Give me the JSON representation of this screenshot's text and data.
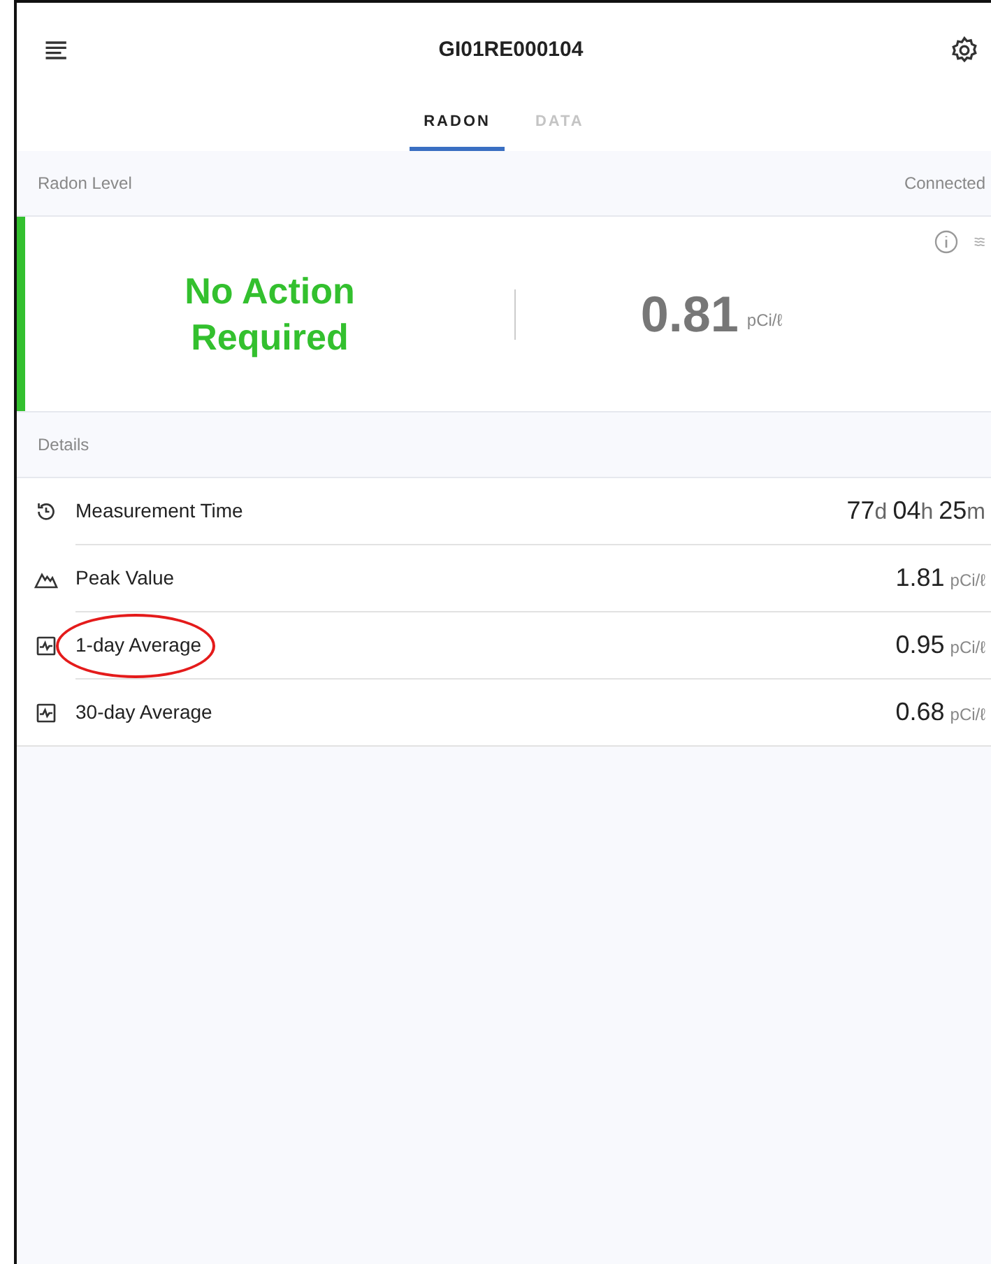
{
  "header": {
    "title": "GI01RE000104"
  },
  "tabs": [
    {
      "label": "RADON",
      "selected": true
    },
    {
      "label": "DATA",
      "selected": false
    }
  ],
  "radon_level": {
    "label": "Radon Level",
    "connection": "Connected",
    "status": "No Action Required",
    "color": "#33c02e",
    "value": "0.81",
    "unit": "pCi/ℓ"
  },
  "details": {
    "label": "Details",
    "rows": [
      {
        "kind": "clock",
        "label": "Measurement Time",
        "circled": false,
        "value_parts": [
          {
            "number": "77",
            "unit": "d"
          },
          {
            "number": "04",
            "unit": "h"
          },
          {
            "number": "25",
            "unit": "m"
          }
        ]
      },
      {
        "kind": "peak",
        "label": "Peak Value",
        "circled": false,
        "value_parts": [
          {
            "number": "1.81",
            "unit": "pCi/ℓ"
          }
        ]
      },
      {
        "kind": "chart",
        "label": "1-day Average",
        "circled": true,
        "value_parts": [
          {
            "number": "0.95",
            "unit": "pCi/ℓ"
          }
        ]
      },
      {
        "kind": "chart",
        "label": "30-day Average",
        "circled": false,
        "value_parts": [
          {
            "number": "0.68",
            "unit": "pCi/ℓ"
          }
        ]
      }
    ]
  }
}
